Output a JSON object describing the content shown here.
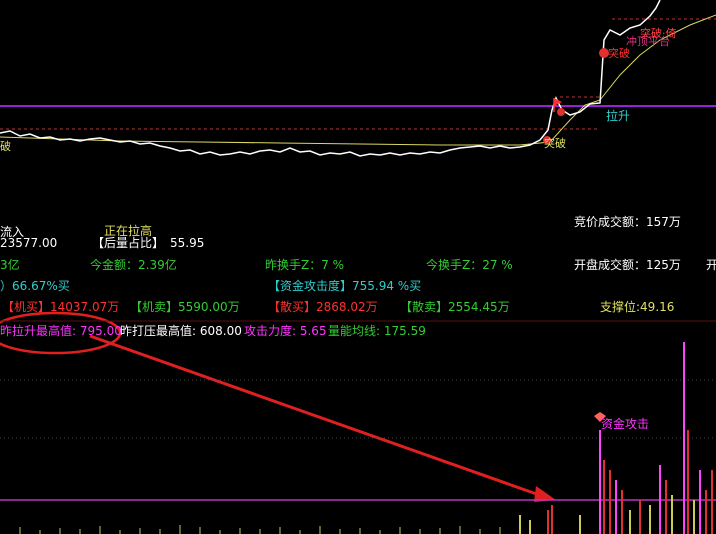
{
  "colors": {
    "white": "#ffffff",
    "yellow": "#e0e060",
    "green": "#33cc33",
    "red": "#ff3030",
    "magenta": "#ff33ff",
    "cyan": "#33cccc",
    "purple": "#9a1fd6",
    "darkred": "#8a1a1a"
  },
  "price_chart": {
    "labels": {
      "left_po": "破",
      "tupo_low": "突破",
      "tupo_mid": "突破",
      "tupo_top": "突破",
      "lasheng": "拉升",
      "xingtai": "冲顶平台",
      "top_right": "突破·倚"
    }
  },
  "stats": {
    "row1": {
      "left_flow": "流入",
      "status": "正在拉高",
      "auction_amount": "竞价成交额：157万"
    },
    "row2": {
      "left_value": "23577.00",
      "ratio_label": "【后量占比】",
      "ratio_value": "55.95"
    },
    "row3": {
      "left_value": "3亿",
      "today_amount": "今金额：2.39亿",
      "yesterday_turnover": "昨换手Z：7 %",
      "today_turnover": "今换手Z：27 %",
      "open_amount": "开盘成交额：125万",
      "right_cut": "开"
    },
    "row4": {
      "left_value": "）66.67%买",
      "capital_attack": "【资金攻击度】755.94 %买"
    },
    "row5": {
      "inst_buy": "【机买】14037.07万",
      "inst_sell": "【机卖】5590.00万",
      "retail_buy": "【散买】2868.02万",
      "retail_sell": "【散卖】2554.45万",
      "support": "支撑位:49.16"
    }
  },
  "volume_panel": {
    "line1": {
      "yesterday_max": "昨拉升最高值: 795.00",
      "yesterday_press": "昨打压最高值: 608.00",
      "attack_strength": "攻击力度: 5.65",
      "energy_avg": "量能均线: 175.59"
    },
    "capital_attack_label": "资金攻击"
  }
}
